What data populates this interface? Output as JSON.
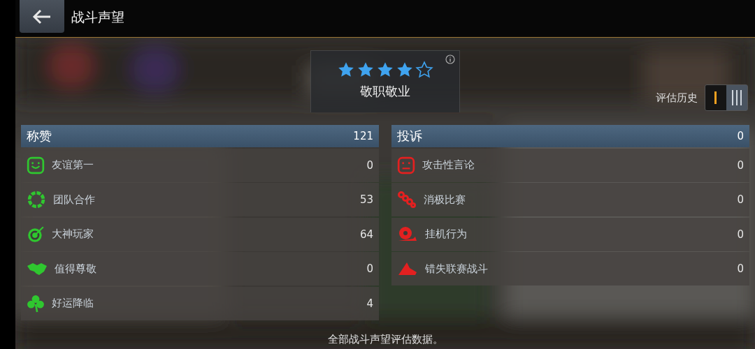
{
  "header": {
    "title": "战斗声望"
  },
  "rating": {
    "stars": 4,
    "title": "敬职敬业"
  },
  "history": {
    "label": "评估历史",
    "options": [
      {
        "kind": "single",
        "selected": false
      },
      {
        "kind": "triple",
        "selected": true
      }
    ]
  },
  "panels": [
    {
      "kind": "praise",
      "title": "称赞",
      "total": "121",
      "rows": [
        {
          "label": "友谊第一",
          "count": "0"
        },
        {
          "label": "团队合作",
          "count": "53"
        },
        {
          "label": "大神玩家",
          "count": "64"
        },
        {
          "label": "值得尊敬",
          "count": "0"
        },
        {
          "label": "好运降临",
          "count": "4"
        }
      ]
    },
    {
      "kind": "complaint",
      "title": "投诉",
      "total": "0",
      "rows": [
        {
          "label": "攻击性言论",
          "count": "0"
        },
        {
          "label": "消极比赛",
          "count": "0"
        },
        {
          "label": "挂机行为",
          "count": "0"
        },
        {
          "label": "错失联赛战斗",
          "count": "0"
        }
      ]
    }
  ],
  "footer": "全部战斗声望评估数据。"
}
